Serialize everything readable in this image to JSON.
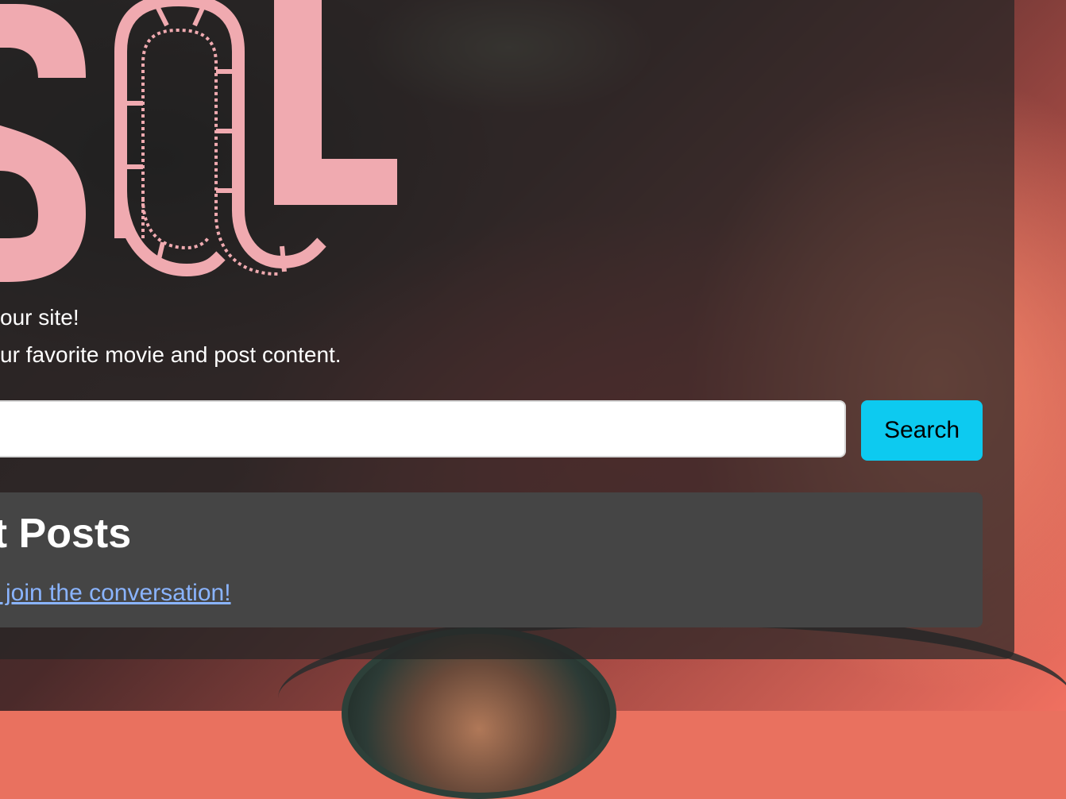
{
  "hero": {
    "logo_text": "SQL",
    "tagline_1": "our site!",
    "tagline_2": "ur favorite movie and post content."
  },
  "search": {
    "value": "",
    "placeholder": "",
    "button_label": "Search"
  },
  "posts": {
    "title": "nt Posts",
    "join_link": "o join the conversation!"
  },
  "colors": {
    "logo_pink": "#f0aab0",
    "accent": "#0dcaf0",
    "link": "#8ab4ff",
    "card": "#454545"
  }
}
